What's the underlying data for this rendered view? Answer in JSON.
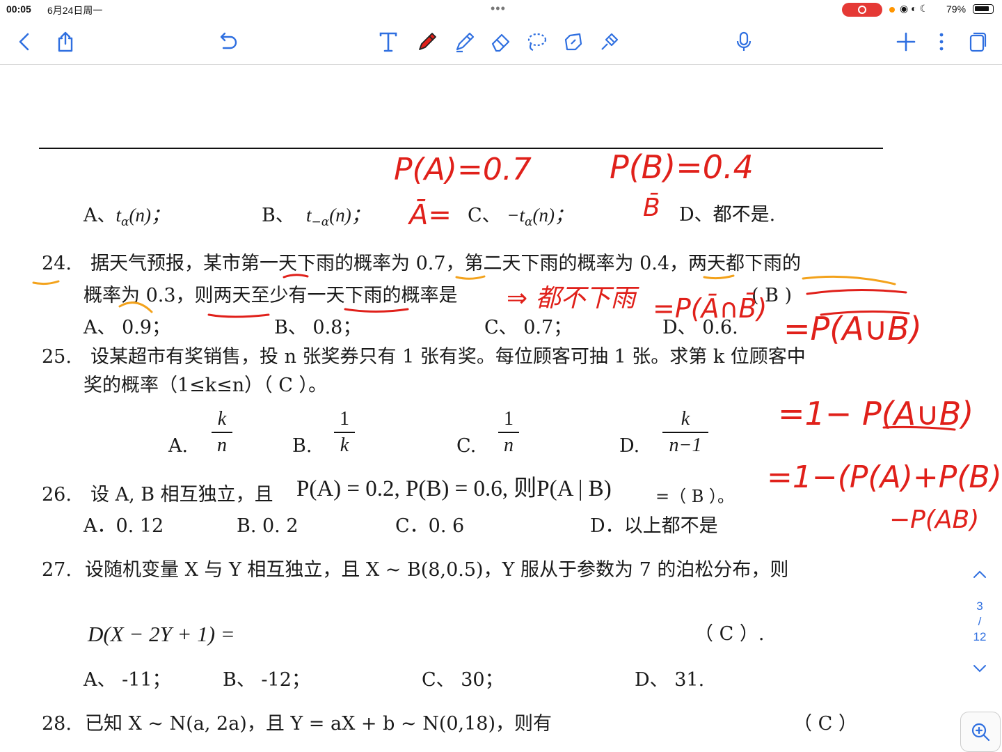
{
  "status": {
    "time": "00:05",
    "date": "6月24日周一",
    "battery": "79%"
  },
  "page": {
    "current": "3",
    "sep": "/",
    "total": "12"
  },
  "q23": {
    "a": "A、",
    "a_t": "t",
    "a_sub": "α",
    "a_arg": "(n)；",
    "b": "B、",
    "b_t": "t",
    "b_sub": "−α",
    "b_arg": "(n)；",
    "c": "C、",
    "c_t": "−t",
    "c_sub": "α",
    "c_arg": "(n)；",
    "d": "D、都不是."
  },
  "q24": {
    "num": "24.",
    "line1": "据天气预报，某市第一天下雨的概率为 0.7，第二天下雨的概率为 0.4，两天都下雨的",
    "line2": "概率为 0.3，则两天至少有一天下雨的概率是",
    "answer": "(  B  )",
    "a": "A、   0.9；",
    "b": "B、    0.8；",
    "c": "C、    0.7；",
    "d": "D、   0.6."
  },
  "q25": {
    "num": "25.",
    "line1": "设某超市有奖销售，投 n 张奖券只有 1 张有奖。每位顾客可抽 1 张。求第 k 位顾客中",
    "line2": "奖的概率（1≤k≤n）（     C  ）。",
    "a": "A.",
    "a_num": "k",
    "a_den": "n",
    "b": "B.",
    "b_num": "1",
    "b_den": "k",
    "c": "C.",
    "c_num": "1",
    "c_den": "n",
    "d": "D.",
    "d_num": "k",
    "d_den": "n−1"
  },
  "q26": {
    "num": "26.",
    "text": "设 A, B 相互独立，且",
    "formula": "P(A) = 0.2, P(B) = 0.6, 则P(A | B)",
    "answer": "=（   B   ）。",
    "a": "A．0. 12",
    "b": "B. 0. 2",
    "c": "C．0. 6",
    "d": "D．以上都不是"
  },
  "q27": {
    "num": "27.",
    "line1": "设随机变量 X 与 Y 相互独立，且 X ~ B(8,0.5)，Y 服从于参数为  7  的泊松分布，则",
    "formula": "D(X − 2Y + 1) =",
    "answer": "（  C  ）.",
    "a": "A、  -11；",
    "b": "B、   -12；",
    "c": "C、    30；",
    "d": "D、   31."
  },
  "q28": {
    "num": "28.",
    "text": "已知 X ~ N(a, 2a)，且 Y = aX + b ~ N(0,18)，则有",
    "answer": "（  C   ）"
  },
  "ink_notes": {
    "pa": "P(A)=0.7",
    "pb": "P(B)=0.4",
    "abar": "Ā=",
    "bbar": "B̄",
    "both": "⇒ 都不下雨",
    "eq1": "=P(Ā∩B̄)",
    "eq2": "=P(A∪B)",
    "eq3": "=1− P(A∪B)",
    "eq4": "=1−(P(A)+P(B)",
    "eq5": "−P(AB)"
  },
  "colors": {
    "ink": "#e0201a",
    "highlight": "#f3a21b",
    "accent": "#2f6fe0"
  }
}
